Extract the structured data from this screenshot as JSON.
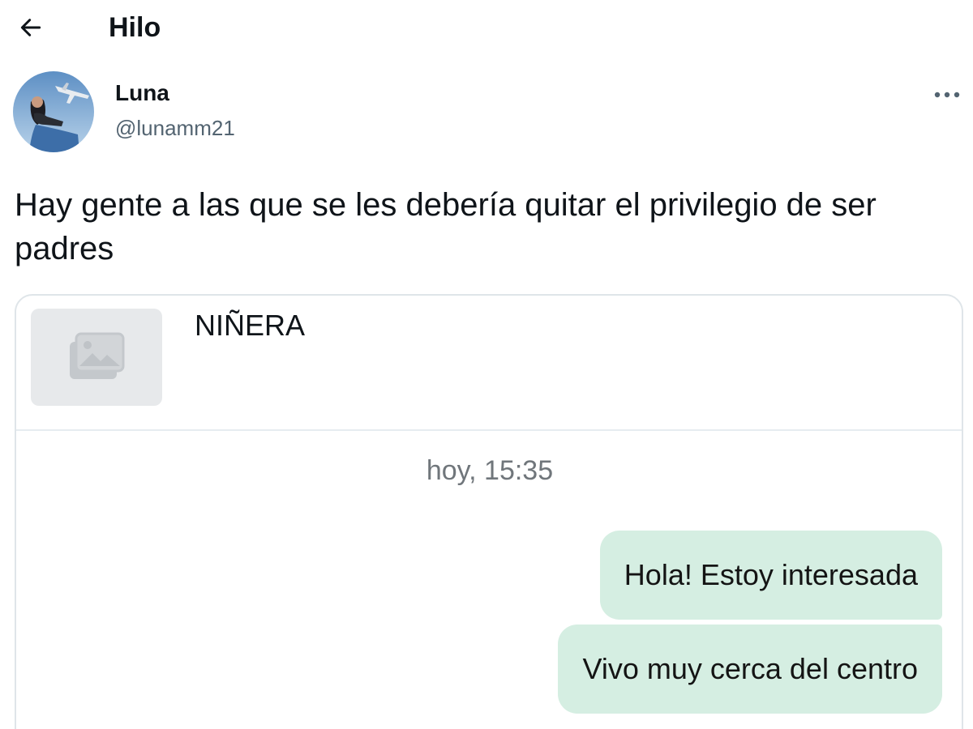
{
  "header": {
    "title": "Hilo",
    "back_icon": "arrow-left-icon"
  },
  "tweet": {
    "author": {
      "name": "Luna",
      "handle": "@lunamm21"
    },
    "text": "Hay gente a las que se les debería quitar el privilegio de ser padres",
    "more_icon": "more-horizontal-icon"
  },
  "card": {
    "title": "NIÑERA",
    "thumbnail_icon": "image-placeholder-icon",
    "chat": {
      "timestamp": "hoy, 15:35",
      "messages": [
        {
          "text": "Hola! Estoy interesada"
        },
        {
          "text": "Vivo muy cerca del centro"
        }
      ]
    }
  },
  "colors": {
    "text_primary": "#0f1419",
    "text_secondary": "#536471",
    "bubble_bg": "#d5eee2",
    "card_border": "#dfe5e9"
  }
}
